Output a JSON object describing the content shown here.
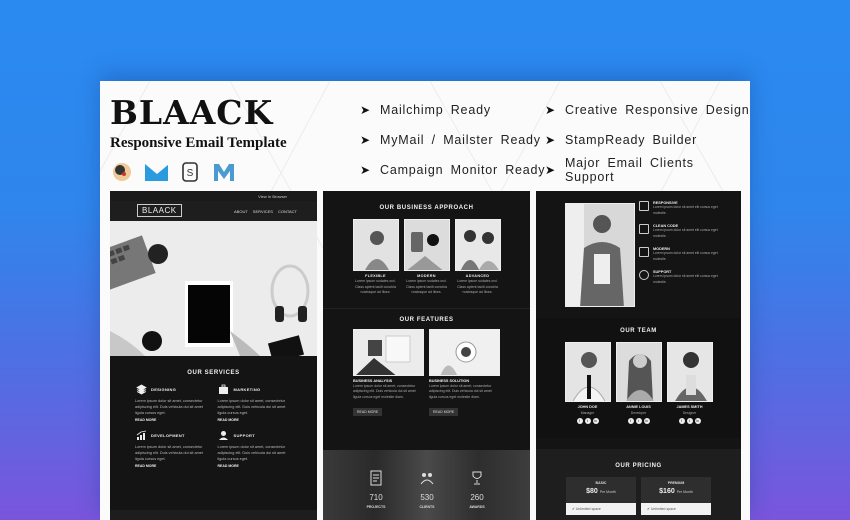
{
  "header": {
    "title": "BLAACK",
    "subtitle": "Responsive Email Template",
    "platform_logos": [
      "mailchimp-icon",
      "mymail-icon",
      "stampready-icon",
      "campaign-monitor-icon"
    ]
  },
  "features_left": [
    "Mailchimp Ready",
    "MyMail / Mailster Ready",
    "Campaign Monitor Ready"
  ],
  "features_right": [
    "Creative Responsive Design",
    "StampReady Builder",
    "Major Email Clients Support"
  ],
  "preview1": {
    "topbar_link": "View In Browser",
    "logo": "BLAACK",
    "menu": [
      "ABOUT",
      "SERVICES",
      "CONTACT"
    ],
    "services_title": "OUR SERVICES",
    "services": [
      {
        "icon": "layers-icon",
        "title": "DESIGNING",
        "text": "Lorem ipsum dolor sit amet, consectetur adipiscing elit. Duis vehicula dui sit amet ligula cursus eget.",
        "more": "READ MORE"
      },
      {
        "icon": "briefcase-icon",
        "title": "MARKETING",
        "text": "Lorem ipsum dolor sit amet, consectetur adipiscing elit. Duis vehicula dui sit amet ligula cursus eget.",
        "more": "READ MORE"
      },
      {
        "icon": "chart-growth-icon",
        "title": "DEVELOPMENT",
        "text": "Lorem ipsum dolor sit amet, consectetur adipiscing elit. Duis vehicula dui sit amet ligula cursus eget.",
        "more": "READ MORE"
      },
      {
        "icon": "support-agent-icon",
        "title": "SUPPORT",
        "text": "Lorem ipsum dolor sit amet, consectetur adipiscing elit. Duis vehicula dui sit amet ligula cursus eget.",
        "more": "READ MORE"
      }
    ]
  },
  "preview2": {
    "approach_title": "OUR BUSINESS APPROACH",
    "approach": [
      {
        "title": "FLEXIBLE",
        "text": "Lorem ipsum sodales orci. Class aptent taciti conubia nostraque ad litora."
      },
      {
        "title": "MODERN",
        "text": "Lorem ipsum sodales orci. Class aptent taciti conubia nostraque ad litora."
      },
      {
        "title": "ADVANCED",
        "text": "Lorem ipsum sodales orci. Class aptent taciti conubia nostraque ad litora."
      }
    ],
    "features_title": "OUR FEATURES",
    "features": [
      {
        "title": "BUSINESS ANALYSIS",
        "text": "Lorem ipsum dolor sit amet, consectetur adipiscing elit. Duis vehicula dui sit amet ligula cursus eget molestie diam.",
        "button": "READ MORE"
      },
      {
        "title": "BUSINESS SOLUTION",
        "text": "Lorem ipsum dolor sit amet, consectetur adipiscing elit. Duis vehicula dui sit amet ligula cursus eget molestie diam.",
        "button": "READ MORE"
      }
    ],
    "stats": [
      {
        "icon": "projects-icon",
        "value": "710",
        "label": "PROJECTS"
      },
      {
        "icon": "clients-icon",
        "value": "530",
        "label": "CLIENTS"
      },
      {
        "icon": "trophy-icon",
        "value": "260",
        "label": "AWARDS"
      }
    ]
  },
  "preview3": {
    "highlights": [
      {
        "icon": "responsive-icon",
        "title": "RESPONSIVE",
        "text": "Lorem ipsum dolor sit amet elit cursus eget molestie."
      },
      {
        "icon": "code-icon",
        "title": "CLEAN CODE",
        "text": "Lorem ipsum dolor sit amet elit cursus eget molestie."
      },
      {
        "icon": "grid-icon",
        "title": "MODERN",
        "text": "Lorem ipsum dolor sit amet elit cursus eget molestie."
      },
      {
        "icon": "headset-icon",
        "title": "SUPPORT",
        "text": "Lorem ipsum dolor sit amet elit cursus eget molestie."
      }
    ],
    "team_title": "OUR TEAM",
    "team": [
      {
        "name": "JOHN DOE",
        "role": "Manager"
      },
      {
        "name": "ANNIE LOUIS",
        "role": "Developer"
      },
      {
        "name": "JAMES SMITH",
        "role": "Designer"
      }
    ],
    "social_icons": [
      "f",
      "t",
      "in"
    ],
    "pricing_title": "OUR PRICING",
    "plans": [
      {
        "name": "BASIC",
        "price": "$80",
        "period": "Per Month",
        "feature": "Unlimited space"
      },
      {
        "name": "PREMIUM",
        "price": "$160",
        "period": "Per Month",
        "feature": "Unlimited space"
      }
    ]
  }
}
